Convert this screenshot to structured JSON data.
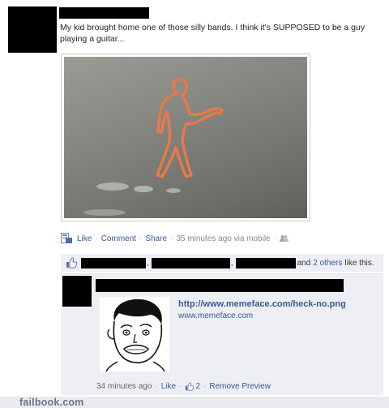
{
  "post": {
    "text": "My kid brought home one of those silly bands. I think it's SUPPOSED to be a guy playing a guitar...",
    "photo_icon": "guitar-player-silly-band-photo"
  },
  "actions": {
    "like": "Like",
    "comment": "Comment",
    "share": "Share",
    "time": "35 minutes ago via mobile",
    "dot": "·"
  },
  "likes": {
    "comma": ",",
    "and_text": "and",
    "others_link": "2 others",
    "suffix": "like this."
  },
  "comment": {
    "link_url": "http://www.memeface.com/heck-no.png",
    "link_domain": "www.memeface.com",
    "time": "34 minutes ago",
    "like": "Like",
    "like_count": "2",
    "remove_preview": "Remove Preview",
    "dot": "·"
  },
  "footer": {
    "watermark": "failbook.com"
  },
  "colors": {
    "link": "#3b5998",
    "likes_bg": "#edeff4",
    "band_orange": "#e8794a"
  }
}
